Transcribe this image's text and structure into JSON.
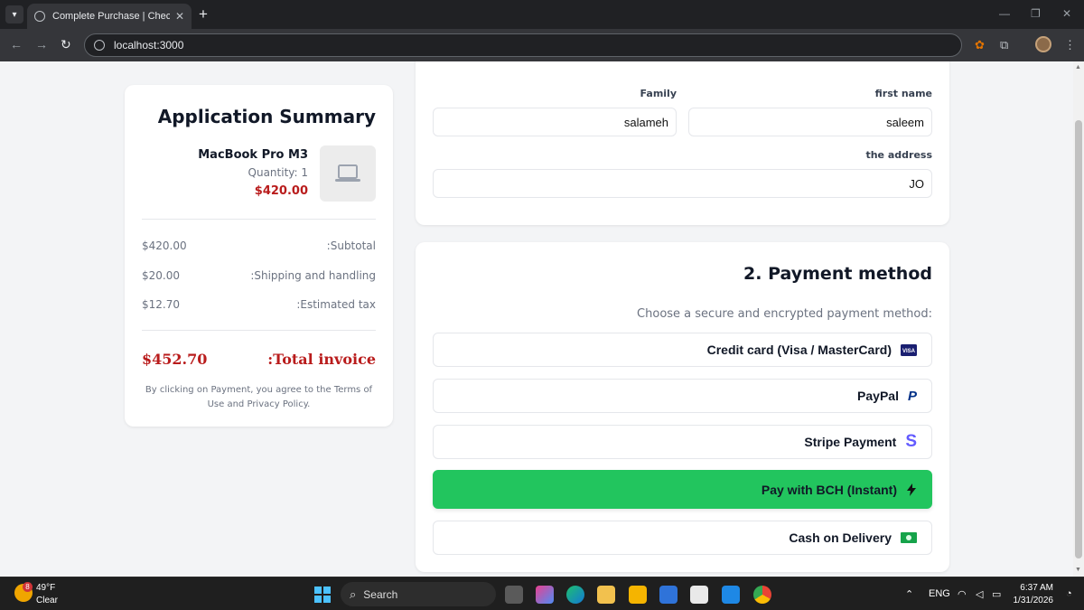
{
  "browser": {
    "tab_title": "Complete Purchase | Checkout",
    "url": "localhost:3000"
  },
  "summary": {
    "title": "Application Summary",
    "product": {
      "name": "MacBook Pro M3",
      "quantity": "Quantity: 1",
      "price": "$420.00"
    },
    "rows": [
      {
        "label": "Subtotal:",
        "value": "$420.00"
      },
      {
        "label": "Shipping and handling:",
        "value": "$20.00"
      },
      {
        "label": "Estimated tax:",
        "value": "$12.70"
      }
    ],
    "total_label": "Total invoice:",
    "total_value": "$452.70",
    "terms": "By clicking on Payment, you agree to the Terms of Use and Privacy Policy."
  },
  "shipping": {
    "family_label": "Family",
    "family_value": "salameh",
    "first_name_label": "first name",
    "first_name_value": "saleem",
    "address_label": "the address",
    "address_value": "JO"
  },
  "payment": {
    "title": "2. Payment method",
    "subtitle": "Choose a secure and encrypted payment method:",
    "options": [
      {
        "label": "Credit card (Visa / MasterCard)",
        "icon": "visa-card-icon"
      },
      {
        "label": "PayPal",
        "icon": "paypal-icon"
      },
      {
        "label": "Stripe Payment",
        "icon": "stripe-icon"
      },
      {
        "label": "Pay with BCH (Instant)",
        "icon": "lightning-icon"
      },
      {
        "label": "Cash on Delivery",
        "icon": "cash-icon"
      }
    ],
    "colors": {
      "bch": "#22c55e",
      "price": "#b91c1c"
    }
  },
  "taskbar": {
    "temperature": "49°F",
    "condition": "Clear",
    "weather_badge": "8",
    "search_label": "Search",
    "language": "ENG",
    "time": "6:37 AM",
    "date": "1/31/2026"
  }
}
